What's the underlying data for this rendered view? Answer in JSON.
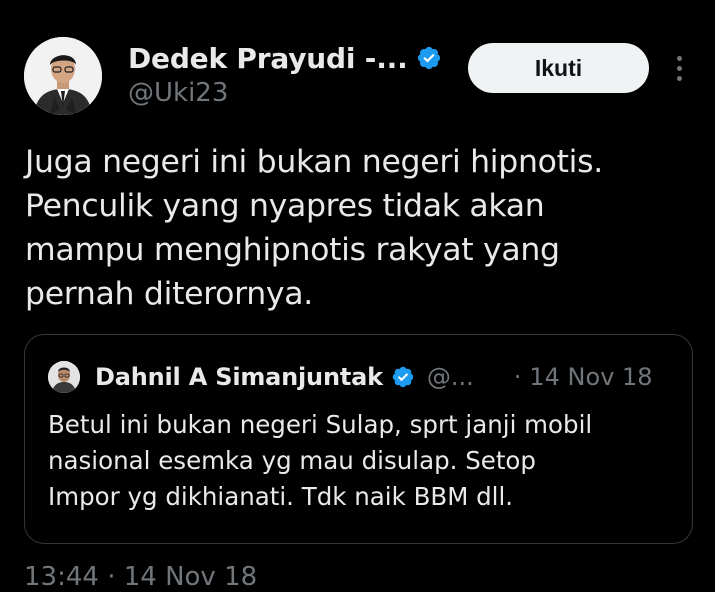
{
  "author": {
    "display_name": "Dedek Prayudi -...",
    "handle": "@Uki23",
    "verified_icon": "verified-badge-icon",
    "avatar_icon": "avatar"
  },
  "follow_button": {
    "label": "Ikuti"
  },
  "more_icon": "more-options-icon",
  "tweet": {
    "lines": [
      "Juga negeri ini bukan negeri hipnotis.",
      "Penculik yang nyapres tidak akan",
      "mampu menghipnotis rakyat yang",
      "pernah diterornya."
    ]
  },
  "quoted_tweet": {
    "display_name": "Dahnil A Simanjuntak",
    "handle": "@...",
    "separator": "·",
    "date": "14 Nov 18",
    "lines": [
      "Betul ini bukan negeri Sulap, sprt janji mobil",
      "nasional esemka yg mau disulap. Setop",
      "Impor yg dikhianati. Tdk naik BBM dll."
    ]
  },
  "timestamp": "13:44 · 14 Nov 18",
  "colors": {
    "background": "#000000",
    "primary_text": "#e7e9ea",
    "secondary_text": "#71767b",
    "verified": "#1d9bf0",
    "border": "#333639",
    "follow_bg": "#eff3f4"
  }
}
